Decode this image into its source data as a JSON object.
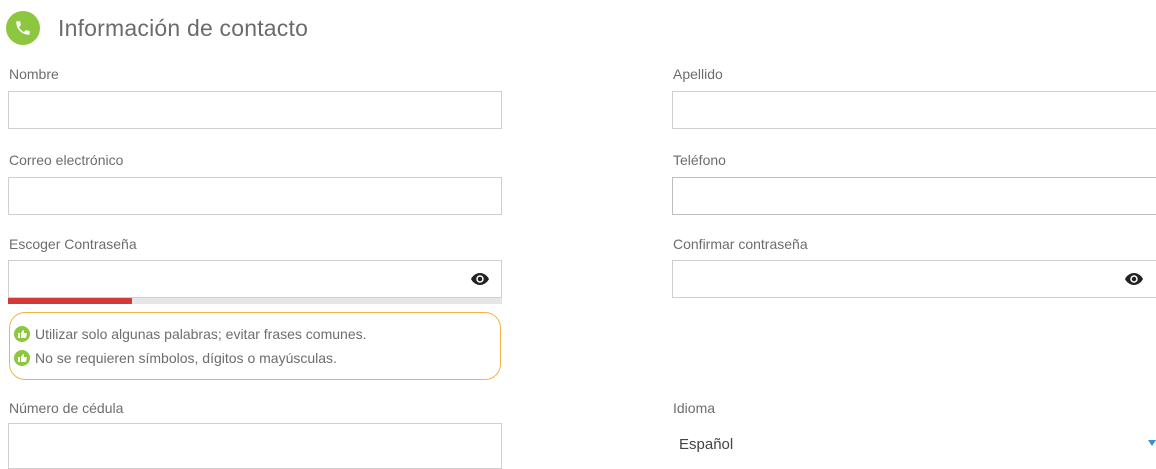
{
  "section": {
    "title": "Información de contacto",
    "icon": "phone-icon",
    "accent_color": "#8dc63f"
  },
  "fields": {
    "nombre": {
      "label": "Nombre",
      "value": ""
    },
    "apellido": {
      "label": "Apellido",
      "value": ""
    },
    "correo": {
      "label": "Correo electrónico",
      "value": ""
    },
    "telefono": {
      "label": "Teléfono",
      "value": ""
    },
    "contrasena": {
      "label": "Escoger Contraseña",
      "value": "",
      "icon": "eye-icon"
    },
    "confirmar": {
      "label": "Confirmar contraseña",
      "value": "",
      "icon": "eye-icon"
    },
    "cedula": {
      "label": "Número de cédula",
      "value": ""
    },
    "idioma": {
      "label": "Idioma",
      "selected": "Español"
    }
  },
  "password_strength": {
    "level": 0.25,
    "color": "#d23a3a"
  },
  "hints": {
    "border_color": "#f3b44a",
    "items": [
      "Utilizar solo algunas palabras; evitar frases comunes.",
      "No se requieren símbolos, dígitos o mayúsculas."
    ]
  }
}
